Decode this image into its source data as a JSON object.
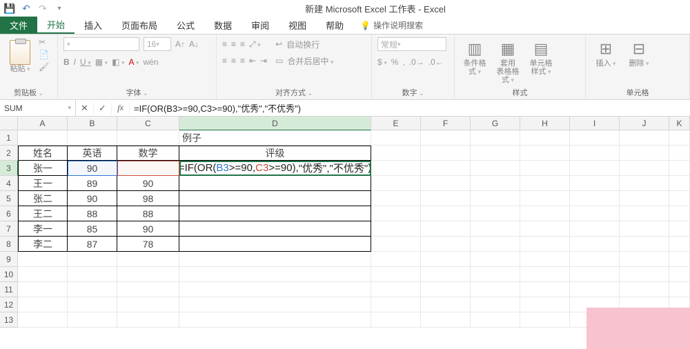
{
  "title": "新建 Microsoft Excel 工作表 - Excel",
  "tabs": {
    "file": "文件",
    "home": "开始",
    "insert": "插入",
    "layout": "页面布局",
    "formulas": "公式",
    "data": "数据",
    "review": "审阅",
    "view": "视图",
    "help": "帮助",
    "tell": "操作说明搜索"
  },
  "ribbon": {
    "clipboard": {
      "label": "剪贴板",
      "paste": "粘贴"
    },
    "font": {
      "label": "字体",
      "size": "16",
      "bold": "B",
      "italic": "I",
      "underline": "U"
    },
    "alignment": {
      "label": "对齐方式",
      "wrap": "自动换行",
      "merge": "合并后居中"
    },
    "number": {
      "label": "数字",
      "format": "常规",
      "percent": "%"
    },
    "styles": {
      "label": "样式",
      "cond": "条件格式",
      "table": "套用\n表格格式",
      "cell": "单元格样式"
    },
    "cells": {
      "label": "单元格",
      "insert": "插入",
      "delete": "删除"
    }
  },
  "namebox": "SUM",
  "formula": "=IF(OR(B3>=90,C3>=90),\"优秀\",\"不优秀\")",
  "columns": [
    "A",
    "B",
    "C",
    "D",
    "E",
    "F",
    "G",
    "H",
    "I",
    "J",
    "K"
  ],
  "sheet": {
    "d1": "例子",
    "headers": {
      "a": "姓名",
      "b": "英语",
      "c": "数学",
      "d": "评级"
    },
    "rows": [
      {
        "name": "张一",
        "eng": "90",
        "math": "",
        "d": "formula"
      },
      {
        "name": "王一",
        "eng": "89",
        "math": "90"
      },
      {
        "name": "张二",
        "eng": "90",
        "math": "98"
      },
      {
        "name": "王二",
        "eng": "88",
        "math": "88"
      },
      {
        "name": "李一",
        "eng": "85",
        "math": "90"
      },
      {
        "name": "李二",
        "eng": "87",
        "math": "78"
      }
    ]
  },
  "formula_parts": {
    "eq": "=",
    "if": "IF",
    "open1": "(",
    "or": "OR",
    "open2": "(",
    "b3": "B3",
    "gte1": ">=90,",
    "c3": "C3",
    "gte2": ">=90",
    "close2": "),",
    "s1": "\"优秀\",\"不优秀\"",
    "close1": ")"
  }
}
